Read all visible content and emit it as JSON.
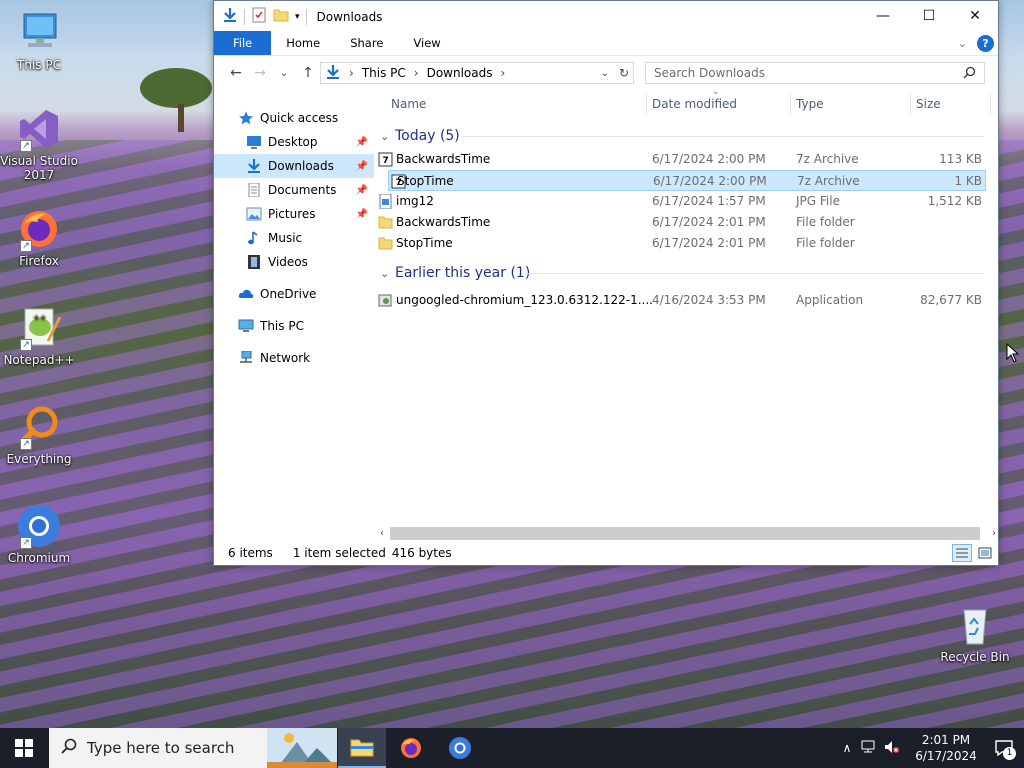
{
  "desktop": {
    "icons": [
      {
        "label": "This PC",
        "icon": "monitor-icon"
      },
      {
        "label": "Visual Studio 2017",
        "icon": "visual-studio-icon"
      },
      {
        "label": "Firefox",
        "icon": "firefox-icon"
      },
      {
        "label": "Notepad++",
        "icon": "notepadpp-icon"
      },
      {
        "label": "Everything",
        "icon": "everything-search-icon"
      },
      {
        "label": "Chromium",
        "icon": "chromium-icon"
      },
      {
        "label": "Recycle Bin",
        "icon": "recycle-bin-icon"
      }
    ]
  },
  "explorer": {
    "title": "Downloads",
    "ribbon_tabs": [
      "File",
      "Home",
      "Share",
      "View"
    ],
    "address": {
      "segments": [
        "This PC",
        "Downloads"
      ]
    },
    "search": {
      "placeholder": "Search Downloads"
    },
    "nav_pane": [
      {
        "label": "Quick access",
        "icon": "star-icon",
        "pinned": false
      },
      {
        "label": "Desktop",
        "icon": "desktop-folder-icon",
        "pinned": true
      },
      {
        "label": "Downloads",
        "icon": "downloads-arrow-icon",
        "pinned": true,
        "selected": true
      },
      {
        "label": "Documents",
        "icon": "documents-icon",
        "pinned": true
      },
      {
        "label": "Pictures",
        "icon": "pictures-icon",
        "pinned": true
      },
      {
        "label": "Music",
        "icon": "music-note-icon",
        "pinned": false
      },
      {
        "label": "Videos",
        "icon": "film-icon",
        "pinned": false
      },
      {
        "label": "OneDrive",
        "icon": "cloud-icon",
        "pinned": false
      },
      {
        "label": "This PC",
        "icon": "monitor-icon",
        "pinned": false
      },
      {
        "label": "Network",
        "icon": "network-icon",
        "pinned": false
      }
    ],
    "columns": [
      "Name",
      "Date modified",
      "Type",
      "Size"
    ],
    "groups": [
      {
        "label": "Today (5)",
        "files": [
          {
            "name": "BackwardsTime",
            "date": "6/17/2024 2:00 PM",
            "type": "7z Archive",
            "size": "113 KB",
            "icon": "archive-icon"
          },
          {
            "name": "StopTime",
            "date": "6/17/2024 2:00 PM",
            "type": "7z Archive",
            "size": "1 KB",
            "icon": "archive-icon",
            "selected": true
          },
          {
            "name": "img12",
            "date": "6/17/2024 1:57 PM",
            "type": "JPG File",
            "size": "1,512 KB",
            "icon": "image-file-icon"
          },
          {
            "name": "BackwardsTime",
            "date": "6/17/2024 2:01 PM",
            "type": "File folder",
            "size": "",
            "icon": "folder-icon"
          },
          {
            "name": "StopTime",
            "date": "6/17/2024 2:01 PM",
            "type": "File folder",
            "size": "",
            "icon": "folder-icon"
          }
        ]
      },
      {
        "label": "Earlier this year (1)",
        "files": [
          {
            "name": "ungoogled-chromium_123.0.6312.122-1....",
            "date": "4/16/2024 3:53 PM",
            "type": "Application",
            "size": "82,677 KB",
            "icon": "installer-icon"
          }
        ]
      }
    ],
    "status": {
      "items": "6 items",
      "selected": "1 item selected",
      "size": "416 bytes"
    }
  },
  "taskbar": {
    "search_placeholder": "Type here to search",
    "clock_time": "2:01 PM",
    "clock_date": "6/17/2024",
    "notification_count": "1"
  },
  "colors": {
    "accent": "#1a6dd1",
    "selection": "#cce8ff",
    "selection_border": "#99d1ff",
    "group_header": "#1e3287"
  }
}
